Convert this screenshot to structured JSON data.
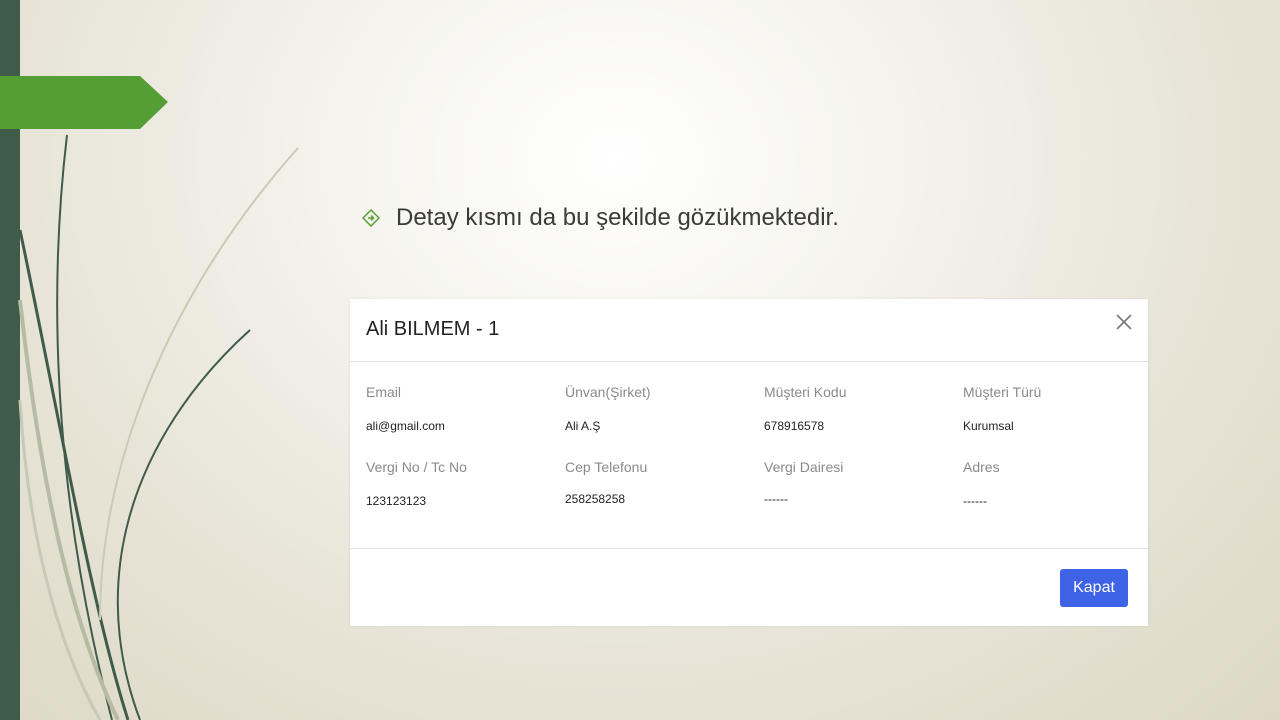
{
  "slide": {
    "bullet_text": "Detay kısmı da bu şekilde gözükmektedir."
  },
  "colors": {
    "side_bar": "#3f5c4b",
    "banner": "#559e36",
    "button": "#3f63e6"
  },
  "icons": {
    "bullet": "diamond-arrow-icon",
    "close": "close-icon"
  },
  "modal": {
    "title": "Ali BILMEM - 1",
    "close_symbol": "×",
    "fields": [
      {
        "label": "Email",
        "value": "ali@gmail.com"
      },
      {
        "label": "Ünvan(Şirket)",
        "value": "Ali A.Ş"
      },
      {
        "label": "Müşteri Kodu",
        "value": "678916578"
      },
      {
        "label": "Müşteri Türü",
        "value": "Kurumsal"
      },
      {
        "label": "Vergi No / Tc No",
        "value": "123123123"
      },
      {
        "label": "Cep Telefonu",
        "value": "258258258"
      },
      {
        "label": "Vergi Dairesi",
        "value": "------"
      },
      {
        "label": "Adres",
        "value": "------"
      }
    ],
    "close_button_label": "Kapat"
  }
}
